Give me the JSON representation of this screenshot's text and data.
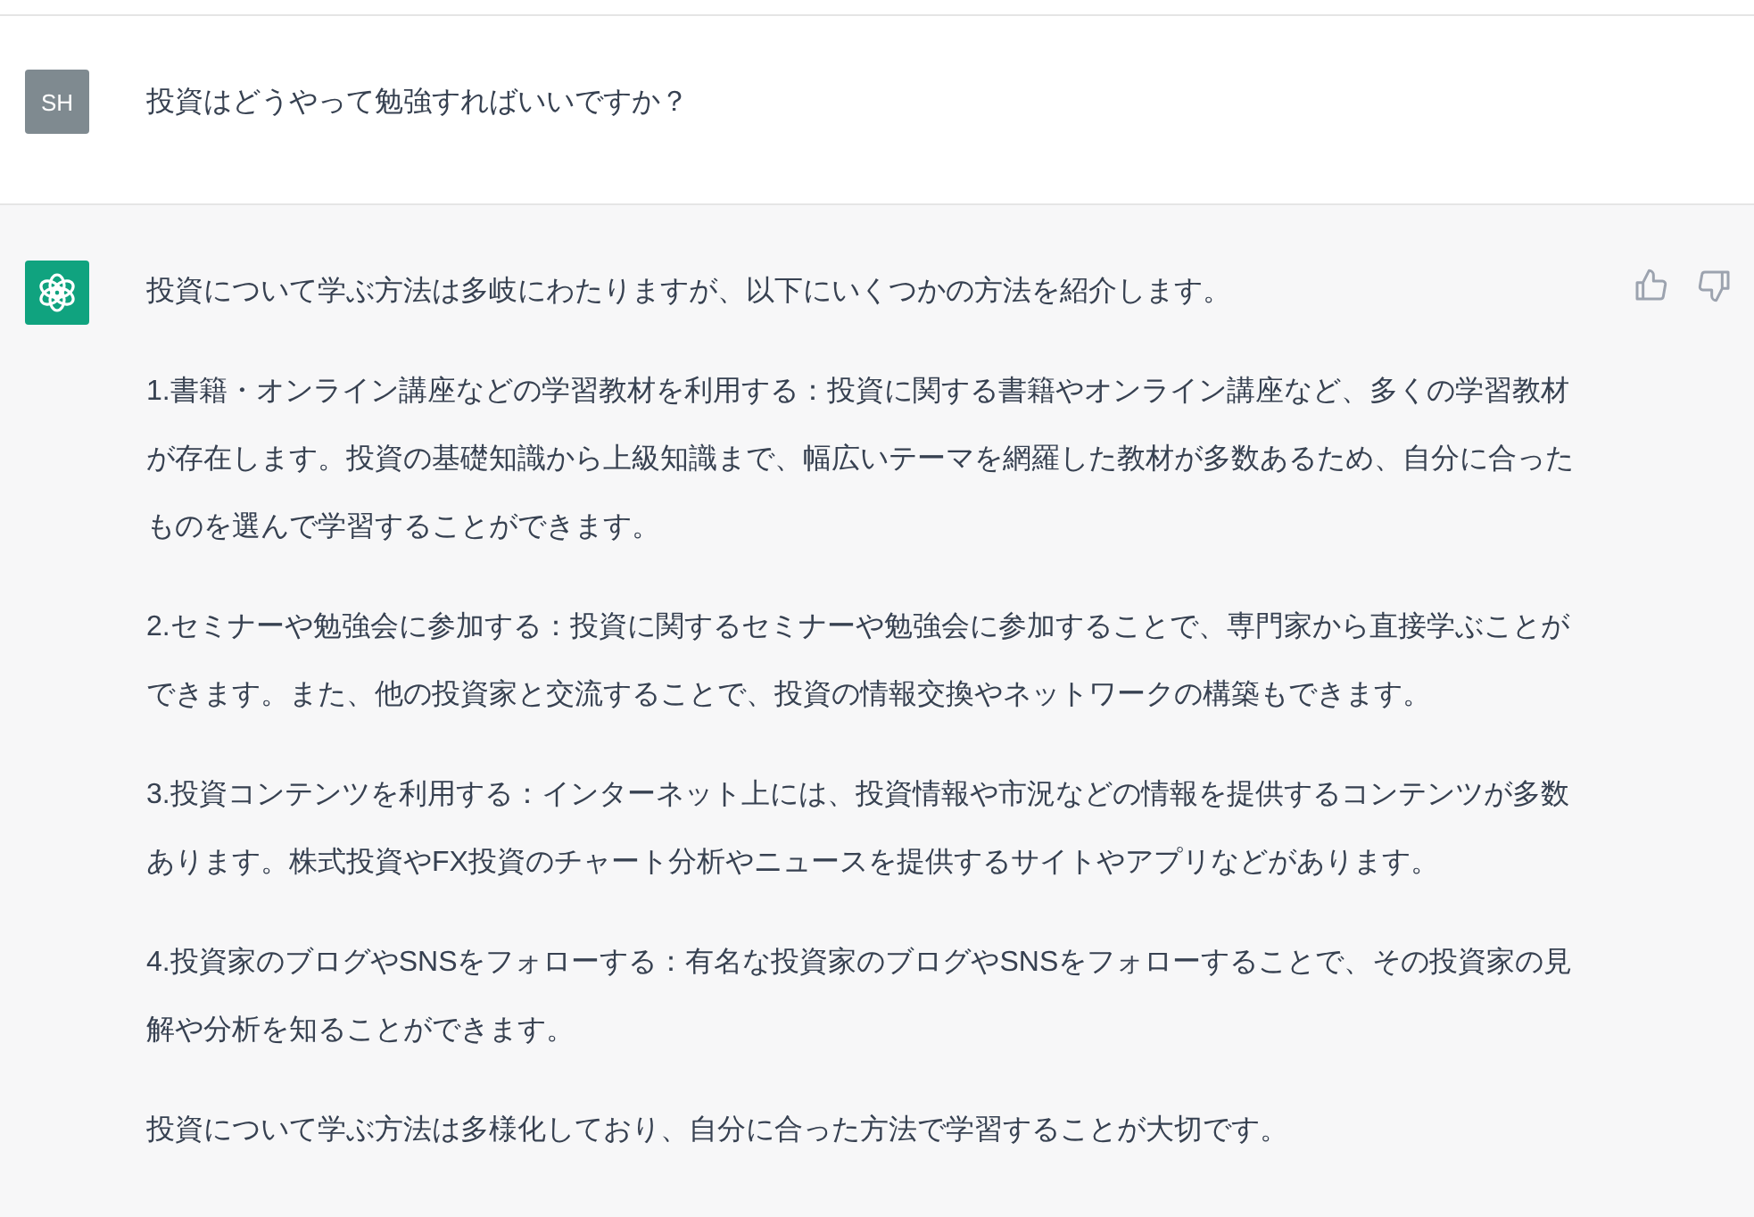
{
  "question": {
    "avatar": "SH",
    "text": "投資はどうやって勉強すればいいですか？"
  },
  "answer": {
    "paragraphs": [
      "投資について学ぶ方法は多岐にわたりますが、以下にいくつかの方法を紹介します。",
      "1.書籍・オンライン講座などの学習教材を利用する：投資に関する書籍やオンライン講座など、多くの学習教材が存在します。投資の基礎知識から上級知識まで、幅広いテーマを網羅した教材が多数あるため、自分に合ったものを選んで学習することができます。",
      "2.セミナーや勉強会に参加する：投資に関するセミナーや勉強会に参加することで、専門家から直接学ぶことができます。また、他の投資家と交流することで、投資の情報交換やネットワークの構築もできます。",
      "3.投資コンテンツを利用する：インターネット上には、投資情報や市況などの情報を提供するコンテンツが多数あります。株式投資やFX投資のチャート分析やニュースを提供するサイトやアプリなどがあります。",
      "4.投資家のブログやSNSをフォローする：有名な投資家のブログやSNSをフォローすることで、その投資家の見解や分析を知ることができます。",
      "投資について学ぶ方法は多様化しており、自分に合った方法で学習することが大切です。"
    ]
  }
}
